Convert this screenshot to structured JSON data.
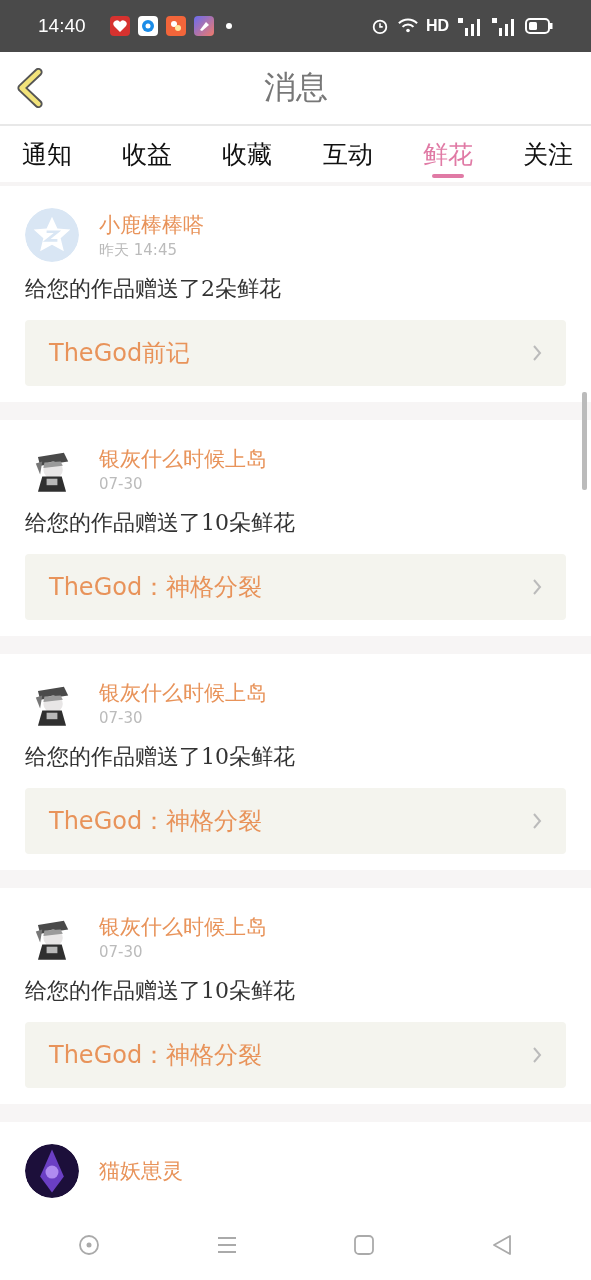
{
  "status_bar": {
    "time": "14:40",
    "network": "HD"
  },
  "header": {
    "title": "消息"
  },
  "tabs": [
    {
      "label": "通知",
      "selected": false
    },
    {
      "label": "收益",
      "selected": false
    },
    {
      "label": "收藏",
      "selected": false
    },
    {
      "label": "互动",
      "selected": false
    },
    {
      "label": "鲜花",
      "selected": true
    },
    {
      "label": "关注",
      "selected": false
    }
  ],
  "messages": [
    {
      "kind": "default",
      "name": "小鹿棒棒嗒",
      "time": "昨天 14:45",
      "text": "给您的作品赠送了2朵鲜花",
      "work": "TheGod前记"
    },
    {
      "kind": "picture",
      "name": "银灰什么时候上岛",
      "time": "07-30",
      "text": "给您的作品赠送了10朵鲜花",
      "work": "TheGod：神格分裂"
    },
    {
      "kind": "picture",
      "name": "银灰什么时候上岛",
      "time": "07-30",
      "text": "给您的作品赠送了10朵鲜花",
      "work": "TheGod：神格分裂"
    },
    {
      "kind": "picture",
      "name": "银灰什么时候上岛",
      "time": "07-30",
      "text": "给您的作品赠送了10朵鲜花",
      "work": "TheGod：神格分裂"
    },
    {
      "kind": "dark",
      "name": "猫妖崽灵"
    }
  ]
}
